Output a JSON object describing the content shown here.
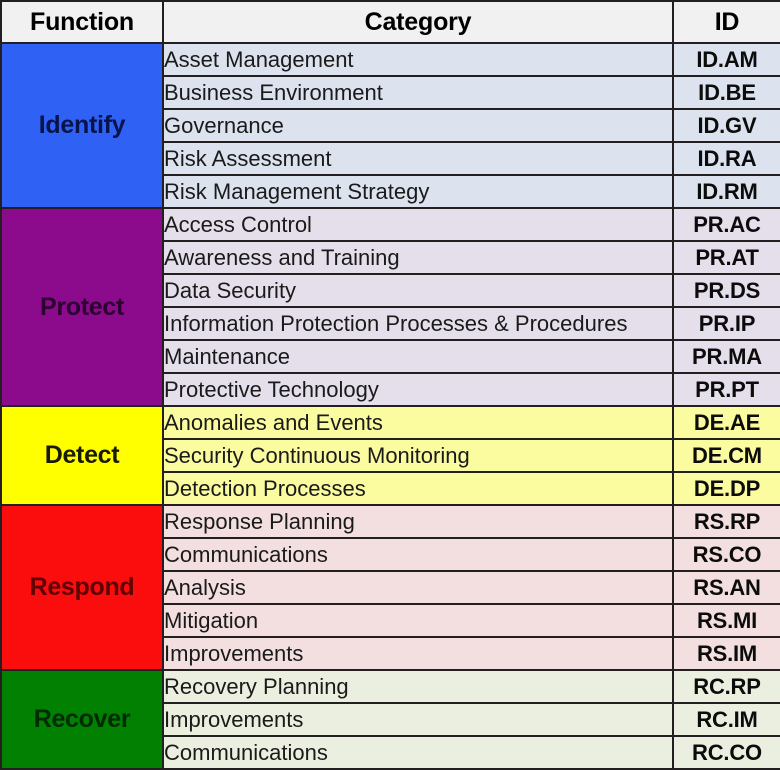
{
  "table": {
    "headers": {
      "function": "Function",
      "category": "Category",
      "id": "ID"
    },
    "colors": {
      "identify": "#2f62f4",
      "protect": "#8c0b8c",
      "detect": "#ffff00",
      "respond": "#fc0d0d",
      "recover": "#018001",
      "identify_tint": "#dce3ef",
      "protect_tint": "#e5dfeb",
      "detect_tint": "#fbfba0",
      "respond_tint": "#f3dfe0",
      "recover_tint": "#ebefdf",
      "header_bg": "#f1f1f1",
      "border": "#231f20"
    },
    "functions": [
      {
        "name": "Identify",
        "rows": [
          {
            "category": "Asset Management",
            "id": "ID.AM"
          },
          {
            "category": "Business Environment",
            "id": "ID.BE"
          },
          {
            "category": "Governance",
            "id": "ID.GV"
          },
          {
            "category": "Risk Assessment",
            "id": "ID.RA"
          },
          {
            "category": "Risk Management Strategy",
            "id": "ID.RM"
          }
        ]
      },
      {
        "name": "Protect",
        "rows": [
          {
            "category": "Access Control",
            "id": "PR.AC"
          },
          {
            "category": "Awareness and Training",
            "id": "PR.AT"
          },
          {
            "category": "Data Security",
            "id": "PR.DS"
          },
          {
            "category": "Information Protection Processes & Procedures",
            "id": "PR.IP"
          },
          {
            "category": "Maintenance",
            "id": "PR.MA"
          },
          {
            "category": "Protective Technology",
            "id": "PR.PT"
          }
        ]
      },
      {
        "name": "Detect",
        "rows": [
          {
            "category": "Anomalies and Events",
            "id": "DE.AE"
          },
          {
            "category": "Security Continuous Monitoring",
            "id": "DE.CM"
          },
          {
            "category": "Detection Processes",
            "id": "DE.DP"
          }
        ]
      },
      {
        "name": "Respond",
        "rows": [
          {
            "category": "Response Planning",
            "id": "RS.RP"
          },
          {
            "category": "Communications",
            "id": "RS.CO"
          },
          {
            "category": "Analysis",
            "id": "RS.AN"
          },
          {
            "category": "Mitigation",
            "id": "RS.MI"
          },
          {
            "category": "Improvements",
            "id": "RS.IM"
          }
        ]
      },
      {
        "name": "Recover",
        "rows": [
          {
            "category": "Recovery Planning",
            "id": "RC.RP"
          },
          {
            "category": "Improvements",
            "id": "RC.IM"
          },
          {
            "category": "Communications",
            "id": "RC.CO"
          }
        ]
      }
    ]
  }
}
